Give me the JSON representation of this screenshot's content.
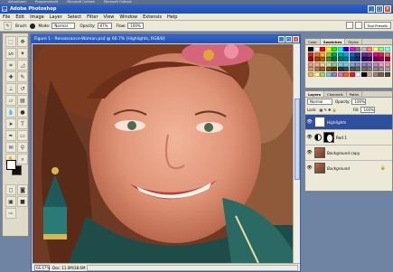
{
  "taskbar": {
    "items": [
      "Aktualisiert",
      "Programmheft",
      "Microsoft Outlook",
      "Microsoft Outlook"
    ]
  },
  "app": {
    "title": "Adobe Photoshop"
  },
  "menu": [
    "File",
    "Edit",
    "Image",
    "Layer",
    "Select",
    "Filter",
    "View",
    "Window",
    "Extensis",
    "Help"
  ],
  "options": {
    "brush_label": "Brush:",
    "mode_label": "Mode:",
    "mode_value": "Normal",
    "opacity_label": "Opacity:",
    "opacity_value": "87%",
    "flow_label": "Flow:",
    "flow_value": "100%",
    "tool_presets_tab": "Tool Presets"
  },
  "document": {
    "title": "Figure 1 - Renaissance-Woman.psd @ 66.7% (Highlights, RGB/8)",
    "zoom": "66.67%",
    "doc_size": "Doc: 11.0M/38.6M"
  },
  "swatches_panel": {
    "tabs": [
      "Color",
      "Swatches",
      "Styles"
    ],
    "colors": [
      "#000000",
      "#ffffff",
      "#ff0000",
      "#ffff00",
      "#00ff00",
      "#00ffff",
      "#0000ff",
      "#ff00ff",
      "#7f7f7f",
      "#bfbfbf",
      "#ff8080",
      "#ffff80",
      "#80ff80",
      "#80ffff",
      "#e31b23",
      "#f36f21",
      "#fdb913",
      "#8dc63f",
      "#00a651",
      "#00a99d",
      "#00aeef",
      "#0072bc",
      "#2e3192",
      "#662d91",
      "#92278f",
      "#ec008c",
      "#ed145b",
      "#f26c4f",
      "#9e0b0f",
      "#a0410d",
      "#a3620a",
      "#598527",
      "#007236",
      "#00746b",
      "#0076a3",
      "#004a80",
      "#003471",
      "#1b1464",
      "#440e62",
      "#630460",
      "#9e005d",
      "#9e0039",
      "#f7977a",
      "#f9ad81",
      "#fdc68a",
      "#c4df9b",
      "#82ca9c",
      "#7bcdc8",
      "#6dcff6",
      "#7da7d9",
      "#8393ca",
      "#8781bd",
      "#a187be",
      "#bd8cbf",
      "#f49ac1",
      "#f6989d",
      "#c69c6d",
      "#a67c52",
      "#8c6239",
      "#754c24",
      "#603913",
      "#363636",
      "#464646",
      "#555555",
      "#626262",
      "#707070",
      "#7d7d7d",
      "#898989",
      "#959595",
      "#a1a1a1",
      "#fbaf5d",
      "#fff799",
      "#acd373",
      "#7accc8",
      "#8882be",
      "#f06eaa",
      "#f26522",
      "#ed1c24",
      "#ffffff",
      "#000000",
      "#c7b299",
      "#998675",
      "#736357",
      "#534741"
    ]
  },
  "layers_panel": {
    "tabs": [
      "Layers",
      "Channels",
      "Paths"
    ],
    "blend_mode": "Normal",
    "opacity_label": "Opacity:",
    "opacity_value": "100%",
    "lock_label": "Lock:",
    "fill_label": "Fill:",
    "fill_value": "100%",
    "layers": [
      {
        "name": "Highlights",
        "selected": true
      },
      {
        "name": "Red 1",
        "selected": false
      },
      {
        "name": "Background copy",
        "selected": false
      },
      {
        "name": "Background",
        "selected": false
      }
    ]
  },
  "icons": {
    "eye": "eye-icon",
    "lock": "lock-icon"
  },
  "colors": {
    "title_blue": "#2251b0",
    "selected_layer": "#2e4f9e",
    "chrome": "#ece9d8"
  }
}
